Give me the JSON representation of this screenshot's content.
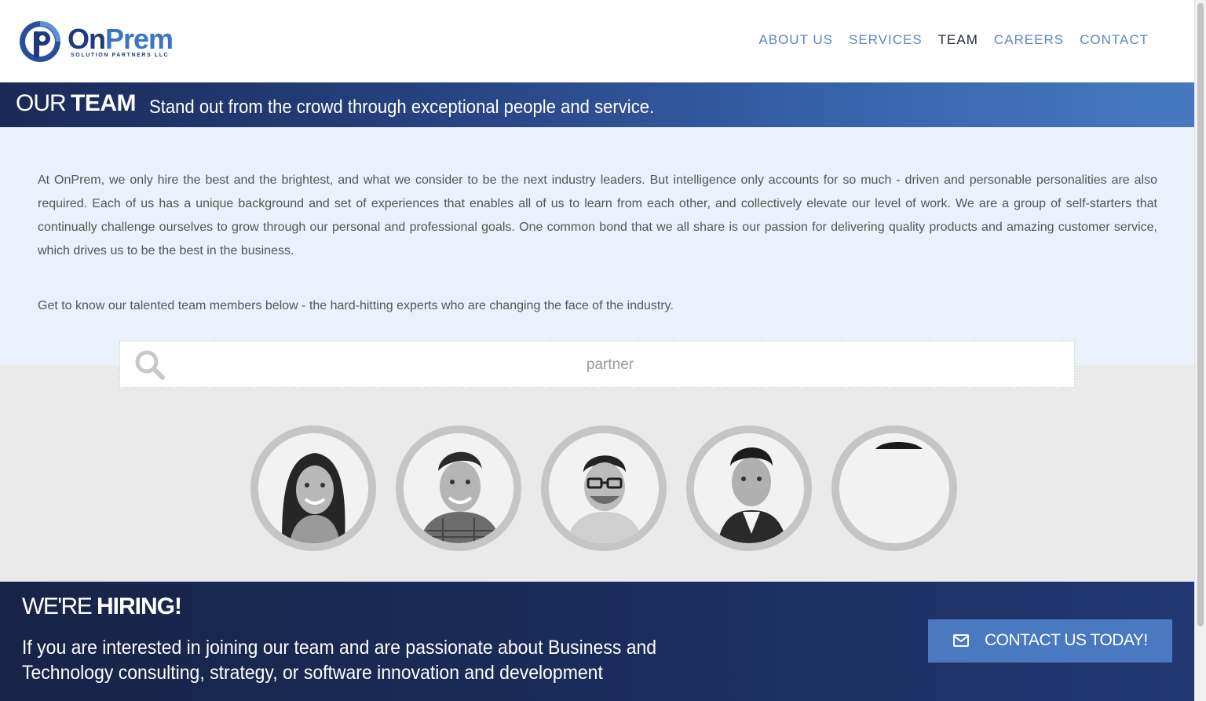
{
  "header": {
    "logo_name_on": "On",
    "logo_name_prem": "Prem",
    "logo_sub": "SOLUTION PARTNERS LLC",
    "nav": [
      {
        "label": "ABOUT US",
        "active": false
      },
      {
        "label": "SERVICES",
        "active": false
      },
      {
        "label": "TEAM",
        "active": true
      },
      {
        "label": "CAREERS",
        "active": false
      },
      {
        "label": "CONTACT",
        "active": false
      }
    ]
  },
  "banner": {
    "our": "OUR",
    "team": "TEAM",
    "tagline": "Stand out from the crowd through exceptional people and service."
  },
  "intro": {
    "paragraph1": "At OnPrem, we only hire the best and the brightest, and what we consider to be the next industry leaders. But intelligence only accounts for so much - driven and personable personalities are also required. Each of us has a unique background and set of experiences that enables all of us to learn from each other, and collectively elevate our level of work. We are a group of self-starters that continually challenge ourselves to grow through our personal and professional goals. One common bond that we all share is our passion for delivering quality products and amazing customer service, which drives us to be the best in the business.",
    "paragraph2": "Get to know our talented team members below - the hard-hitting experts who are changing the face of the industry."
  },
  "search": {
    "value": "partner",
    "icon": "search-icon"
  },
  "members": [
    {
      "photo": "woman-smiling-photo"
    },
    {
      "photo": "man-smiling-plaid-shirt-photo"
    },
    {
      "photo": "man-glasses-photo"
    },
    {
      "photo": "man-suit-photo"
    },
    {
      "photo": "man-photo-partially-loaded"
    }
  ],
  "hiring": {
    "were": "WE'RE",
    "hiring": "HIRING!",
    "text": "If you are interested in joining our team and are passionate about Business and Technology consulting, strategy, or software innovation and development",
    "cta_label": "CONTACT US TODAY!",
    "cta_icon": "envelope-icon"
  },
  "colors": {
    "nav": "#5b87c8",
    "nav_active": "#222a36",
    "banner_start": "#1a2a57",
    "banner_end": "#4779c1",
    "intro_bg": "#eaf1fa",
    "team_bg": "#eaeaea",
    "hiring_bg": "#1b2d5d",
    "cta_bg": "#4a78c1"
  }
}
